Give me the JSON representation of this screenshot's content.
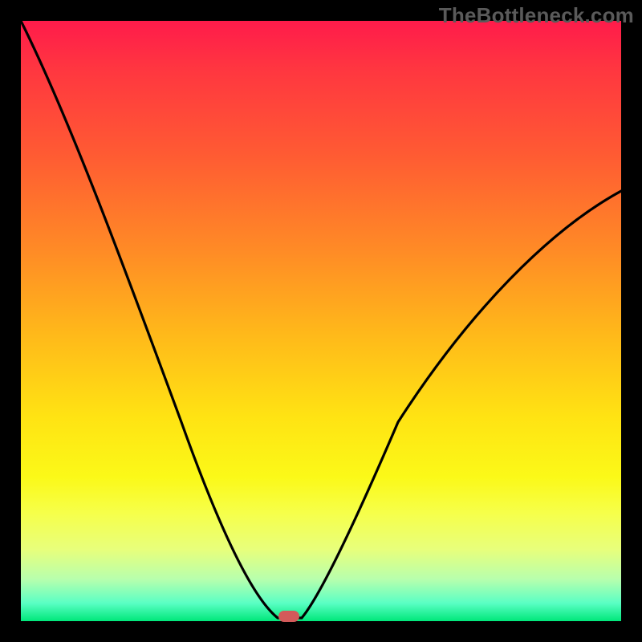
{
  "watermark": "TheBottleneck.com",
  "chart_data": {
    "type": "line",
    "title": "",
    "xlabel": "",
    "ylabel": "",
    "xlim": [
      0,
      100
    ],
    "ylim": [
      0,
      100
    ],
    "grid": false,
    "legend": false,
    "background_gradient": {
      "top": "#ff1b4b",
      "middle": "#ffe313",
      "bottom": "#00e77a"
    },
    "series": [
      {
        "name": "bottleneck-curve",
        "color": "#000000",
        "x": [
          0,
          5,
          10,
          15,
          20,
          25,
          30,
          35,
          40,
          42,
          44,
          45,
          46,
          47,
          48,
          50,
          55,
          60,
          65,
          70,
          75,
          80,
          85,
          90,
          95,
          100
        ],
        "values": [
          100,
          87,
          74,
          62,
          50,
          38,
          28,
          18,
          9,
          5,
          2,
          0,
          0,
          0,
          2,
          5,
          14,
          23,
          31,
          39,
          46,
          52,
          58,
          63,
          67,
          71
        ]
      }
    ],
    "marker": {
      "x": 45,
      "y": 0,
      "color": "#d35a5a",
      "shape": "rounded-rect"
    }
  }
}
